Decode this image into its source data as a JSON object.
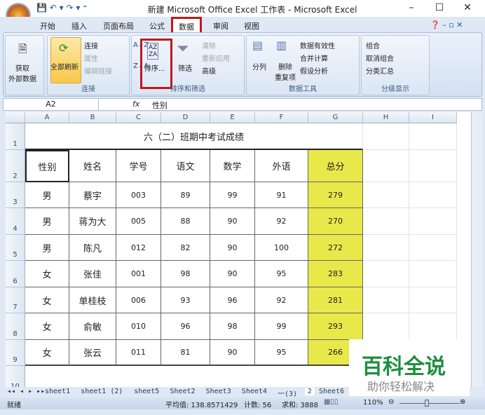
{
  "title": "新建 Microsoft Office Excel 工作表 - Microsoft Excel",
  "tabs": [
    "开始",
    "插入",
    "页面布局",
    "公式",
    "数据",
    "审阅",
    "视图"
  ],
  "ribbon": {
    "get_external": "获取\n外部数据",
    "refresh_all": "全部刷新",
    "connections": "连接",
    "properties": "属性",
    "edit_links": "编辑链接",
    "group_connections": "连接",
    "sort": "排序...",
    "filter": "筛选",
    "clear": "清除",
    "reapply": "重新应用",
    "advanced": "高级",
    "group_sort": "排序和筛选",
    "text_to_columns": "分列",
    "remove_dup": "删除\n重复项",
    "data_validation": "数据有效性",
    "consolidate": "合并计算",
    "what_if": "假设分析",
    "group_tools": "数据工具",
    "group": "组合",
    "ungroup": "取消组合",
    "subtotal": "分类汇总",
    "group_outline": "分级显示"
  },
  "formula": {
    "name_box": "A2",
    "fx": "fx",
    "value": "性别"
  },
  "columns": [
    "A",
    "B",
    "C",
    "D",
    "E",
    "F",
    "G",
    "H",
    "I"
  ],
  "rows": [
    "1",
    "2",
    "3",
    "4",
    "5",
    "6",
    "7",
    "8",
    "9",
    "10"
  ],
  "table": {
    "title": "六（二）班期中考试成绩",
    "headers": [
      "性别",
      "姓名",
      "学号",
      "语文",
      "数学",
      "外语",
      "总分"
    ],
    "data": [
      [
        "男",
        "蔡宇",
        "003",
        "89",
        "99",
        "91",
        "279"
      ],
      [
        "男",
        "蒋为大",
        "005",
        "88",
        "90",
        "92",
        "270"
      ],
      [
        "男",
        "陈凡",
        "012",
        "82",
        "90",
        "100",
        "272"
      ],
      [
        "女",
        "张佳",
        "001",
        "98",
        "90",
        "95",
        "283"
      ],
      [
        "女",
        "单桂枝",
        "006",
        "93",
        "96",
        "92",
        "281"
      ],
      [
        "女",
        "俞敏",
        "010",
        "96",
        "98",
        "99",
        "293"
      ],
      [
        "女",
        "张云",
        "011",
        "81",
        "90",
        "95",
        "266"
      ]
    ]
  },
  "sheets": [
    "sheet1",
    "sheet1 (2)",
    "sheet5",
    "Sheet2",
    "Sheet3",
    "Sheet4",
    "一(3)",
    "2",
    "Sheet6"
  ],
  "status": {
    "ready": "就绪",
    "average": "平均值: 138.8571429",
    "count": "计数: 56",
    "sum": "求和: 3888",
    "zoom": "110%"
  },
  "watermark": {
    "brand": "百科全说",
    "slogan": "助你轻松解决"
  }
}
